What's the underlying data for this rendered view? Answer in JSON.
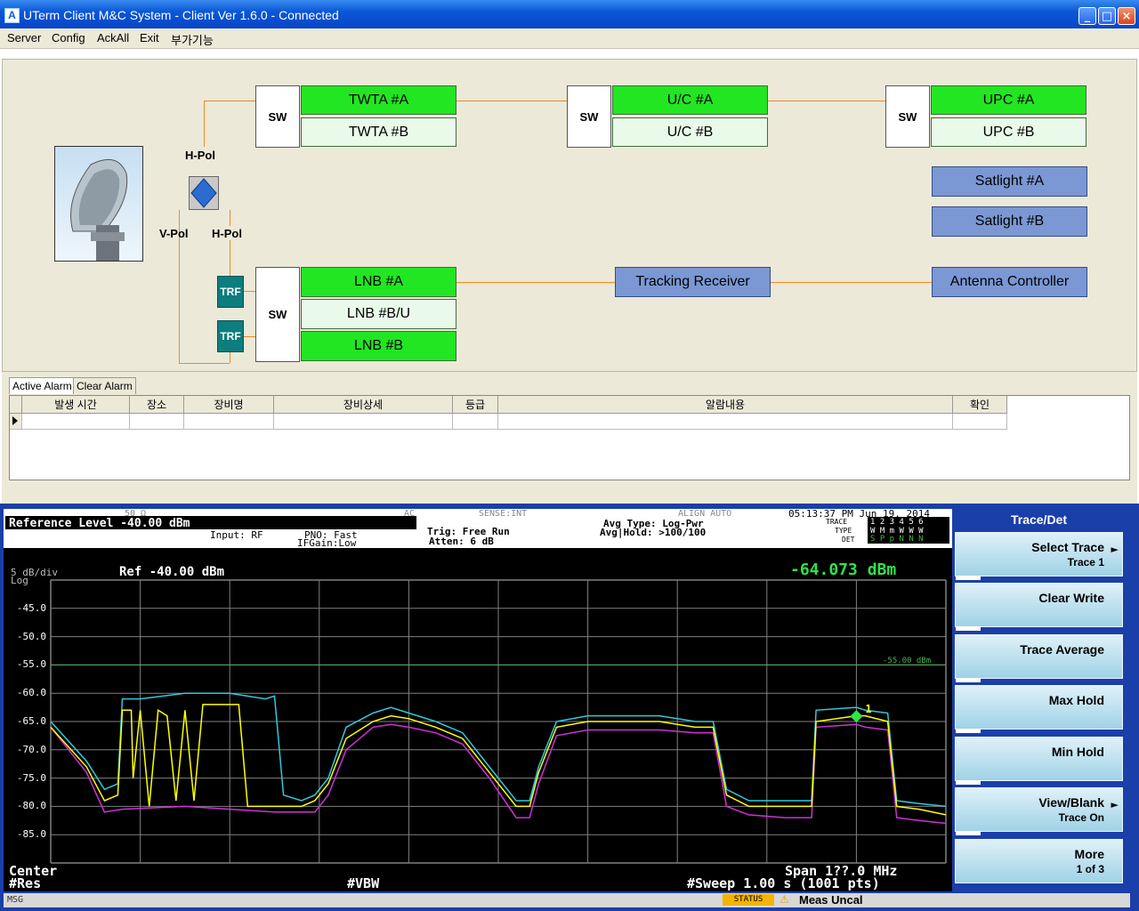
{
  "window": {
    "title": "UTerm Client M&C System - Client Ver 1.6.0 -  Connected",
    "minimize": "_",
    "maximize": "□",
    "close": "×"
  },
  "menu": [
    "Server",
    "Config",
    "AckAll",
    "Exit",
    "부가기능"
  ],
  "diagram": {
    "sw_label": "SW",
    "h_pol": "H-Pol",
    "v_pol": "V-Pol",
    "trf": "TRF",
    "twta_a": "TWTA #A",
    "twta_b": "TWTA #B",
    "uc_a": "U/C #A",
    "uc_b": "U/C #B",
    "upc_a": "UPC #A",
    "upc_b": "UPC #B",
    "satlight_a": "Satlight #A",
    "satlight_b": "Satlight #B",
    "lnb_a": "LNB #A",
    "lnb_bu": "LNB #B/U",
    "lnb_b": "LNB #B",
    "tracking_receiver": "Tracking Receiver",
    "antenna_controller": "Antenna Controller"
  },
  "alarm": {
    "tabs": [
      "Active Alarm",
      "Clear Alarm"
    ],
    "columns": [
      "발생 시간",
      "장소",
      "장비명",
      "장비상세",
      "등급",
      "알람내용",
      "확인"
    ]
  },
  "analyzer": {
    "header": {
      "impedance": "50 Ω",
      "coupling": "AC",
      "sense": "SENSE:INT",
      "align": "ALIGN AUTO",
      "datetime": "05:13:37 PM Jun 19, 2014",
      "ref_level": "Reference Level  -40.00 dBm",
      "input": "Input: RF",
      "pno": "PNO: Fast",
      "ifgain": "IFGain:Low",
      "trig": "Trig: Free Run",
      "atten": "Atten: 6 dB",
      "avg_type": "Avg Type: Log-Pwr",
      "avg_hold": "Avg|Hold: >100/100",
      "trace_lbl": "TRACE",
      "type_lbl": "TYPE",
      "det_lbl": "DET",
      "trace_val": "1 2 3 4 5 6",
      "type_val": "W M m W W W",
      "det_val": "S P p N N N"
    },
    "scale": "5 dB/div",
    "log": "Log",
    "ref": "Ref -40.00 dBm",
    "marker_value": "-64.073 dBm",
    "marker_label": "1",
    "line_label": "-55.00 dBm",
    "center": "Center",
    "res": "#Res",
    "vbw": "#VBW",
    "span": "Span 1??.0 MHz",
    "sweep": "#Sweep  1.00 s (1001 pts)",
    "status_msg": "MSG",
    "status_lbl": "STATUS",
    "status_text": "Meas Uncal",
    "colors": {
      "yellow": "#ffff00",
      "cyan": "#32c8dc",
      "magenta": "#d030d8",
      "grid": "#808080",
      "display_line": "#4caf50"
    }
  },
  "chart_data": {
    "type": "line",
    "ylabel": "",
    "xlabel": "",
    "yticks": [
      -45.0,
      -50.0,
      -55.0,
      -60.0,
      -65.0,
      -70.0,
      -75.0,
      -80.0,
      -85.0
    ],
    "ytick_labels": [
      "-45.0",
      "-50.0",
      "-55.0",
      "-60.0",
      "-65.0",
      "-70.0",
      "-75.0",
      "-80.0",
      "-85.0"
    ],
    "ylim": [
      -90,
      -40
    ],
    "xlim": [
      0,
      1000
    ],
    "display_line": -55.0,
    "marker": {
      "x": 900,
      "y": -64.073
    },
    "series": [
      {
        "color": "#ffff00",
        "points": [
          [
            0,
            -66
          ],
          [
            40,
            -73
          ],
          [
            60,
            -79
          ],
          [
            75,
            -78
          ],
          [
            80,
            -63
          ],
          [
            90,
            -63
          ],
          [
            92,
            -75
          ],
          [
            100,
            -63
          ],
          [
            110,
            -80
          ],
          [
            120,
            -63
          ],
          [
            130,
            -64
          ],
          [
            140,
            -79
          ],
          [
            150,
            -63
          ],
          [
            160,
            -79
          ],
          [
            170,
            -62
          ],
          [
            180,
            -62
          ],
          [
            200,
            -62
          ],
          [
            210,
            -62
          ],
          [
            220,
            -80
          ],
          [
            230,
            -80
          ],
          [
            250,
            -80
          ],
          [
            280,
            -80
          ],
          [
            295,
            -79
          ],
          [
            310,
            -76
          ],
          [
            330,
            -68
          ],
          [
            360,
            -65
          ],
          [
            380,
            -64
          ],
          [
            400,
            -64.5
          ],
          [
            430,
            -66
          ],
          [
            460,
            -68
          ],
          [
            490,
            -74
          ],
          [
            520,
            -80
          ],
          [
            535,
            -80
          ],
          [
            545,
            -74
          ],
          [
            565,
            -66
          ],
          [
            600,
            -65
          ],
          [
            640,
            -65
          ],
          [
            680,
            -65
          ],
          [
            720,
            -66
          ],
          [
            740,
            -66
          ],
          [
            755,
            -78
          ],
          [
            780,
            -80
          ],
          [
            820,
            -80
          ],
          [
            850,
            -80
          ],
          [
            855,
            -65
          ],
          [
            900,
            -64
          ],
          [
            910,
            -64
          ],
          [
            935,
            -65
          ],
          [
            945,
            -80
          ],
          [
            970,
            -80.5
          ],
          [
            1000,
            -81.5
          ]
        ]
      },
      {
        "color": "#32c8dc",
        "points": [
          [
            0,
            -65
          ],
          [
            40,
            -72
          ],
          [
            60,
            -77
          ],
          [
            75,
            -76
          ],
          [
            80,
            -61
          ],
          [
            90,
            -61
          ],
          [
            100,
            -61
          ],
          [
            150,
            -60
          ],
          [
            200,
            -60
          ],
          [
            240,
            -61
          ],
          [
            250,
            -60.5
          ],
          [
            260,
            -78
          ],
          [
            280,
            -79
          ],
          [
            295,
            -78
          ],
          [
            310,
            -75
          ],
          [
            330,
            -66
          ],
          [
            360,
            -63.5
          ],
          [
            380,
            -62.5
          ],
          [
            400,
            -63.5
          ],
          [
            430,
            -65
          ],
          [
            460,
            -67
          ],
          [
            490,
            -73
          ],
          [
            520,
            -79
          ],
          [
            535,
            -79
          ],
          [
            545,
            -73
          ],
          [
            565,
            -65
          ],
          [
            600,
            -64
          ],
          [
            640,
            -64
          ],
          [
            680,
            -64
          ],
          [
            720,
            -65
          ],
          [
            740,
            -65
          ],
          [
            755,
            -77
          ],
          [
            780,
            -79
          ],
          [
            820,
            -79
          ],
          [
            850,
            -79
          ],
          [
            855,
            -63
          ],
          [
            900,
            -62.5
          ],
          [
            910,
            -63
          ],
          [
            935,
            -63.5
          ],
          [
            945,
            -79
          ],
          [
            970,
            -79.5
          ],
          [
            1000,
            -80
          ]
        ]
      },
      {
        "color": "#d030d8",
        "points": [
          [
            0,
            -66
          ],
          [
            40,
            -74
          ],
          [
            60,
            -81
          ],
          [
            80,
            -80.5
          ],
          [
            150,
            -80
          ],
          [
            200,
            -80.5
          ],
          [
            250,
            -81
          ],
          [
            295,
            -81
          ],
          [
            310,
            -78
          ],
          [
            330,
            -70
          ],
          [
            360,
            -66
          ],
          [
            380,
            -65.5
          ],
          [
            400,
            -66
          ],
          [
            430,
            -67
          ],
          [
            460,
            -69
          ],
          [
            490,
            -75
          ],
          [
            520,
            -82
          ],
          [
            535,
            -82
          ],
          [
            545,
            -76
          ],
          [
            565,
            -67.5
          ],
          [
            600,
            -66.5
          ],
          [
            640,
            -66.5
          ],
          [
            680,
            -66.5
          ],
          [
            720,
            -67
          ],
          [
            740,
            -67
          ],
          [
            755,
            -80
          ],
          [
            780,
            -81.5
          ],
          [
            820,
            -82
          ],
          [
            850,
            -82
          ],
          [
            855,
            -66
          ],
          [
            900,
            -65.5
          ],
          [
            910,
            -66
          ],
          [
            935,
            -66.5
          ],
          [
            945,
            -82
          ],
          [
            970,
            -82.5
          ],
          [
            1000,
            -83
          ]
        ]
      }
    ]
  },
  "softkeys": {
    "title": "Trace/Det",
    "keys": [
      {
        "main": "Select Trace",
        "sub": "Trace 1",
        "arrow": "►"
      },
      {
        "main": "Clear Write",
        "sub": ""
      },
      {
        "main": "Trace Average",
        "sub": ""
      },
      {
        "main": "Max Hold",
        "sub": ""
      },
      {
        "main": "Min Hold",
        "sub": ""
      },
      {
        "main": "View/Blank",
        "sub": "Trace On",
        "arrow": "►"
      },
      {
        "main": "More",
        "sub": "1 of 3"
      }
    ]
  }
}
